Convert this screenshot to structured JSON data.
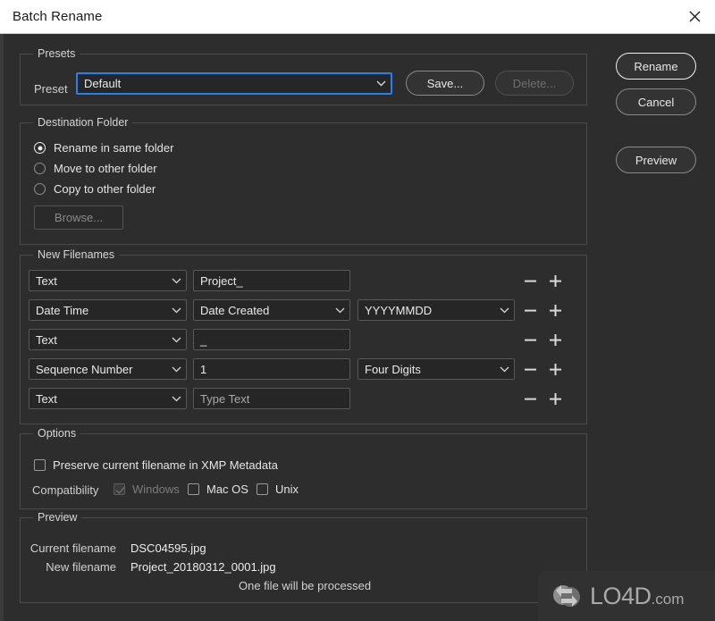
{
  "window": {
    "title": "Batch Rename",
    "close_icon": "close-icon"
  },
  "presets": {
    "group_label": "Presets",
    "preset_label": "Preset",
    "preset_value": "Default",
    "save_label": "Save...",
    "delete_label": "Delete..."
  },
  "destination": {
    "group_label": "Destination Folder",
    "options": [
      {
        "label": "Rename in same folder",
        "selected": true
      },
      {
        "label": "Move to other folder",
        "selected": false
      },
      {
        "label": "Copy to other folder",
        "selected": false
      }
    ],
    "browse_label": "Browse..."
  },
  "new_filenames": {
    "group_label": "New Filenames",
    "rows": [
      {
        "type": "Text",
        "value": "Project_",
        "placeholder": false,
        "extra": null
      },
      {
        "type": "Date Time",
        "value": "Date Created",
        "placeholder": false,
        "extra": "YYYYMMDD"
      },
      {
        "type": "Text",
        "value": "_",
        "placeholder": false,
        "extra": null
      },
      {
        "type": "Sequence Number",
        "value": "1",
        "placeholder": false,
        "extra": "Four Digits"
      },
      {
        "type": "Text",
        "value": "Type Text",
        "placeholder": true,
        "extra": null
      }
    ],
    "remove_icon": "minus-icon",
    "add_icon": "plus-icon"
  },
  "options": {
    "group_label": "Options",
    "preserve_label": "Preserve current filename in XMP Metadata",
    "preserve_checked": false,
    "compatibility_label": "Compatibility",
    "compatibility": [
      {
        "label": "Windows",
        "checked": true,
        "disabled": true
      },
      {
        "label": "Mac OS",
        "checked": false,
        "disabled": false
      },
      {
        "label": "Unix",
        "checked": false,
        "disabled": false
      }
    ]
  },
  "preview": {
    "group_label": "Preview",
    "current_filename_label": "Current filename",
    "current_filename_value": "DSC04595.jpg",
    "new_filename_label": "New filename",
    "new_filename_value": "Project_20180312_0001.jpg",
    "status": "One file will be processed"
  },
  "actions": {
    "rename_label": "Rename",
    "cancel_label": "Cancel",
    "preview_label": "Preview"
  },
  "watermark": {
    "text": "LO4D",
    "suffix": ".com"
  },
  "colors": {
    "dialog_bg": "#2d2d2d",
    "titlebar_bg": "#ffffff",
    "focus_blue": "#2a7ff0",
    "control_bg": "#262626",
    "border": "#4a4a4a"
  }
}
